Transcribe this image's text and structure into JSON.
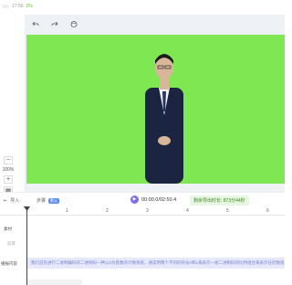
{
  "topbar": {
    "time_text": "17:56",
    "percent_text": "0%"
  },
  "toolbar": {
    "undo_icon": "undo-icon",
    "redo_icon": "redo-icon",
    "settings_icon": "palette-icon"
  },
  "zoom": {
    "minus": "−",
    "value": "100%",
    "plus": "+",
    "fit": "▦"
  },
  "controls": {
    "import_label": "导入",
    "step_label": "步骤",
    "step_badge": "默认",
    "time_text": "00:00.0/02:50.4",
    "remaining_text": "剩余导出时长: 873分44秒"
  },
  "ruler": {
    "labels": [
      "1",
      "2",
      "3",
      "4",
      "5",
      "6"
    ]
  },
  "tracks": {
    "material_label": "素材",
    "background_label": "前景",
    "script_label": "播报内容"
  },
  "narration_text": "我们首先进行二进制编码的二进制码一种以2为基数的计数系统，通常用两个不同的符号0和1来表示一组二进制码的比特组合来表示任何数值，例如二进制码",
  "colors": {
    "stage_green": "#7ee853",
    "play_purple": "#7b6cf6",
    "narration_bg": "#e6e9fb"
  }
}
